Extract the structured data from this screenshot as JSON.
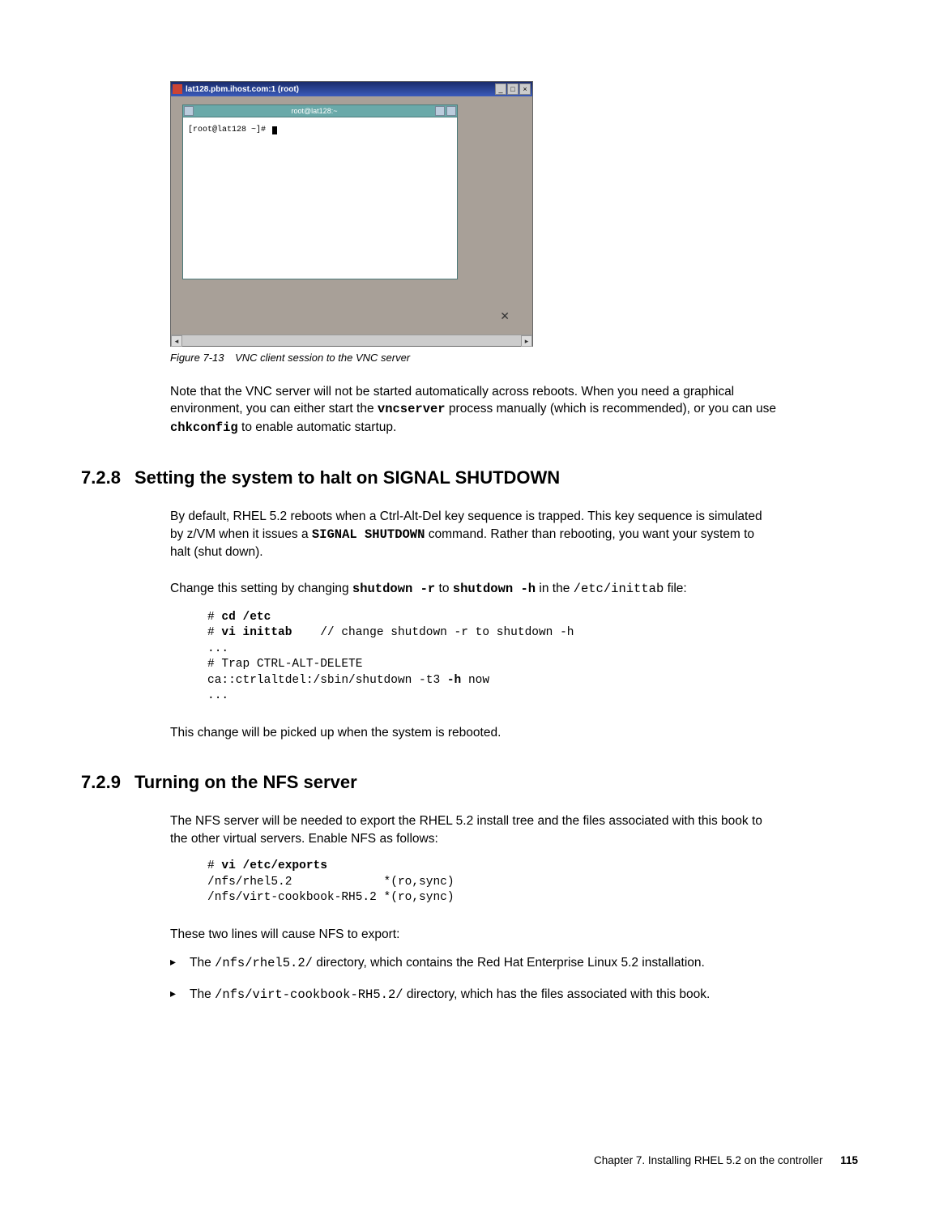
{
  "figure": {
    "outer_title": "lat128.pbm.ihost.com:1 (root)",
    "outer_ctl_min": "_",
    "outer_ctl_max": "□",
    "outer_ctl_close": "×",
    "inner_title": "root@lat128:~",
    "prompt": "[root@lat128 ~]# ",
    "x_symbol": "✕",
    "scroll_left": "◂",
    "scroll_right": "▸",
    "caption_num": "Figure 7-13",
    "caption_text": "VNC client session to the VNC server"
  },
  "para1": {
    "a": "Note that the VNC server will not be started automatically across reboots. When you need a graphical environment, you can either start the ",
    "b": "vncserver",
    "c": " process manually (which is recommended), or you can use ",
    "d": "chkconfig",
    "e": " to enable automatic startup."
  },
  "sec728": {
    "num": "7.2.8",
    "title": "Setting the system to halt on SIGNAL SHUTDOWN"
  },
  "para2": {
    "a": "By default, RHEL 5.2 reboots when a Ctrl-Alt-Del key sequence is trapped. This key sequence is simulated by z/VM when it issues a ",
    "b": "SIGNAL SHUTDOWN",
    "c": " command. Rather than rebooting, you want your system to halt (shut down)."
  },
  "para3": {
    "a": "Change this setting by changing ",
    "b": "shutdown -r",
    "c": " to ",
    "d": "shutdown -h",
    "e": " in the ",
    "f": "/etc/inittab",
    "g": " file:"
  },
  "code1": {
    "l1a": "# ",
    "l1b": "cd /etc",
    "l2a": "# ",
    "l2b": "vi inittab",
    "l2c": "    // change shutdown -r to shutdown -h",
    "l3": "...",
    "l4": "# Trap CTRL-ALT-DELETE",
    "l5a": "ca::ctrlaltdel:/sbin/shutdown -t3 ",
    "l5b": "-h",
    "l5c": " now",
    "l6": "..."
  },
  "para4": "This change will be picked up when the system is rebooted.",
  "sec729": {
    "num": "7.2.9",
    "title": "Turning on the NFS server"
  },
  "para5": "The NFS server will be needed to export the RHEL 5.2 install tree and the files associated with this book to the other virtual servers. Enable NFS as follows:",
  "code2": {
    "l1a": "# ",
    "l1b": "vi /etc/exports",
    "l2": "/nfs/rhel5.2             *(ro,sync)",
    "l3": "/nfs/virt-cookbook-RH5.2 *(ro,sync)"
  },
  "para6": "These two lines will cause NFS to export:",
  "bullet1": {
    "a": "The ",
    "b": "/nfs/rhel5.2/",
    "c": " directory, which contains the Red Hat Enterprise Linux 5.2 installation."
  },
  "bullet2": {
    "a": "The ",
    "b": "/nfs/virt-cookbook-RH5.2/",
    "c": " directory, which has the files associated with this book."
  },
  "footer": {
    "chapter": "Chapter 7. Installing RHEL 5.2 on the controller",
    "page": "115"
  }
}
